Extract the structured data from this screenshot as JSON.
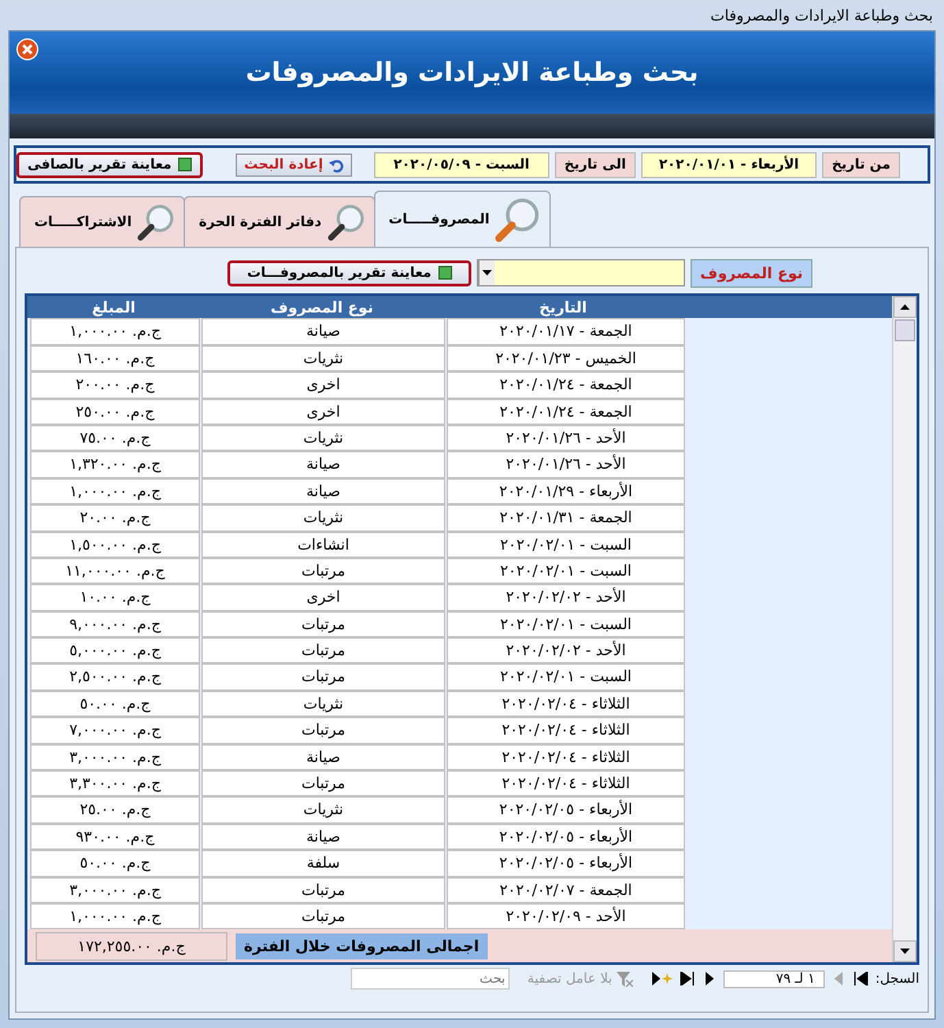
{
  "window": {
    "title": "بحث وطباعة الايرادات والمصروفات"
  },
  "header": {
    "title": "بحث وطباعة الايرادات والمصروفات"
  },
  "filters": {
    "from_label": "من تاريخ",
    "from_value": "الأربعاء - ٢٠٢٠/٠١/٠١",
    "to_label": "الى تاريخ",
    "to_value": "السبت - ٢٠٢٠/٠٥/٠٩",
    "reset_button": "إعادة البحث",
    "preview_net_button": "معاينة تقرير بالصافى"
  },
  "tabs": [
    {
      "label": "المصروفـــــات",
      "selected": true
    },
    {
      "label": "دفاتر الفترة الحرة",
      "selected": false
    },
    {
      "label": "الاشتراكـــــات",
      "selected": false
    }
  ],
  "expense_filter": {
    "label": "نوع المصروف",
    "preview_button": "معاينة تقرير بالمصروفـــات"
  },
  "table": {
    "columns": [
      "التاريخ",
      "نوع المصروف",
      "المبلغ"
    ],
    "rows": [
      [
        "الجمعة - ٢٠٢٠/٠١/١٧",
        "صيانة",
        "ج.م. ١,٠٠٠.٠٠"
      ],
      [
        "الخميس - ٢٠٢٠/٠١/٢٣",
        "نثريات",
        "ج.م. ١٦٠.٠٠"
      ],
      [
        "الجمعة - ٢٠٢٠/٠١/٢٤",
        "اخرى",
        "ج.م. ٢٠٠.٠٠"
      ],
      [
        "الجمعة - ٢٠٢٠/٠١/٢٤",
        "اخرى",
        "ج.م. ٢٥٠.٠٠"
      ],
      [
        "الأحد - ٢٠٢٠/٠١/٢٦",
        "نثريات",
        "ج.م. ٧٥.٠٠"
      ],
      [
        "الأحد - ٢٠٢٠/٠١/٢٦",
        "صيانة",
        "ج.م. ١,٣٢٠.٠٠"
      ],
      [
        "الأربعاء - ٢٠٢٠/٠١/٢٩",
        "صيانة",
        "ج.م. ١,٠٠٠.٠٠"
      ],
      [
        "الجمعة - ٢٠٢٠/٠١/٣١",
        "نثريات",
        "ج.م. ٢٠.٠٠"
      ],
      [
        "السبت - ٢٠٢٠/٠٢/٠١",
        "انشاءات",
        "ج.م. ١,٥٠٠.٠٠"
      ],
      [
        "السبت - ٢٠٢٠/٠٢/٠١",
        "مرتبات",
        "ج.م. ١١,٠٠٠.٠٠"
      ],
      [
        "الأحد - ٢٠٢٠/٠٢/٠٢",
        "اخرى",
        "ج.م. ١٠.٠٠"
      ],
      [
        "السبت - ٢٠٢٠/٠٢/٠١",
        "مرتبات",
        "ج.م. ٩,٠٠٠.٠٠"
      ],
      [
        "الأحد - ٢٠٢٠/٠٢/٠٢",
        "مرتبات",
        "ج.م. ٥,٠٠٠.٠٠"
      ],
      [
        "السبت - ٢٠٢٠/٠٢/٠١",
        "مرتبات",
        "ج.م. ٢,٥٠٠.٠٠"
      ],
      [
        "الثلاثاء - ٢٠٢٠/٠٢/٠٤",
        "نثريات",
        "ج.م. ٥٠.٠٠"
      ],
      [
        "الثلاثاء - ٢٠٢٠/٠٢/٠٤",
        "مرتبات",
        "ج.م. ٧,٠٠٠.٠٠"
      ],
      [
        "الثلاثاء - ٢٠٢٠/٠٢/٠٤",
        "صيانة",
        "ج.م. ٣,٠٠٠.٠٠"
      ],
      [
        "الثلاثاء - ٢٠٢٠/٠٢/٠٤",
        "مرتبات",
        "ج.م. ٣,٣٠٠.٠٠"
      ],
      [
        "الأربعاء - ٢٠٢٠/٠٢/٠٥",
        "نثريات",
        "ج.م. ٢٥.٠٠"
      ],
      [
        "الأربعاء - ٢٠٢٠/٠٢/٠٥",
        "صيانة",
        "ج.م. ٩٣٠.٠٠"
      ],
      [
        "الأربعاء - ٢٠٢٠/٠٢/٠٥",
        "سلفة",
        "ج.م. ٥٠.٠٠"
      ],
      [
        "الجمعة - ٢٠٢٠/٠٢/٠٧",
        "مرتبات",
        "ج.م. ٣,٠٠٠.٠٠"
      ],
      [
        "الأحد - ٢٠٢٠/٠٢/٠٩",
        "مرتبات",
        "ج.م. ١,٠٠٠.٠٠"
      ]
    ]
  },
  "total": {
    "label": "اجمالى المصروفات خلال الفترة",
    "value": "ج.م. ١٧٢,٢٥٥.٠٠"
  },
  "navigator": {
    "record_label": "السجل:",
    "position": "١ لـ ٧٩",
    "filter": "بلا عامل تصفية",
    "search_placeholder": "بحث"
  }
}
